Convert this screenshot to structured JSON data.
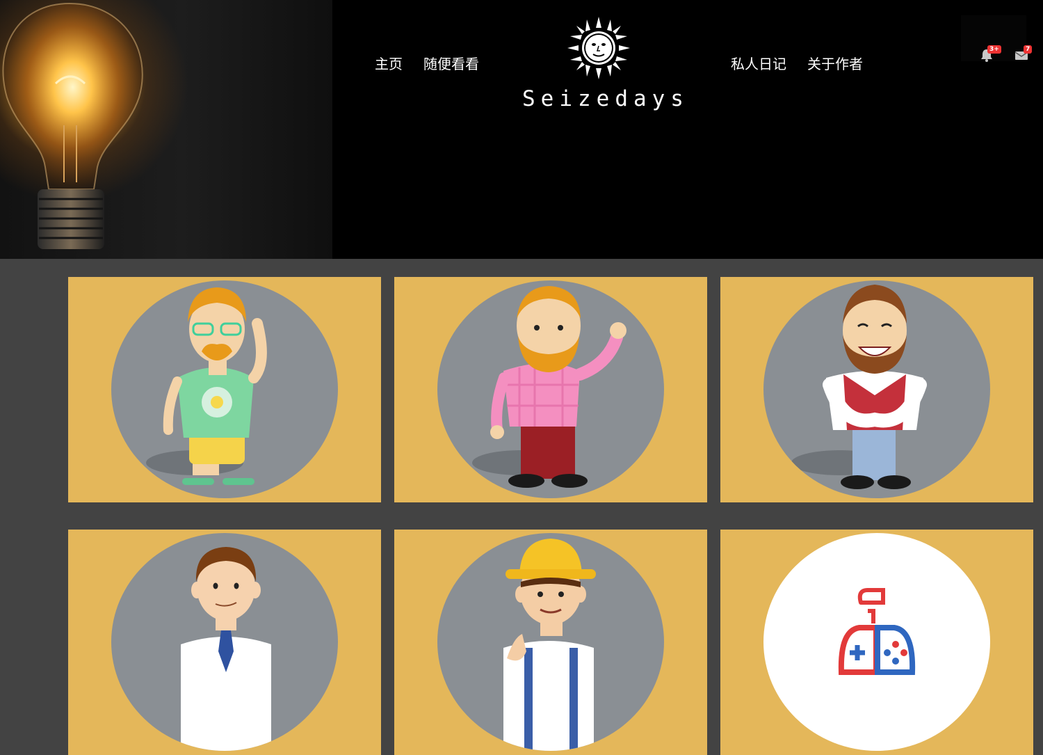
{
  "nav": {
    "left": [
      "主页",
      "随便看看"
    ],
    "right": [
      "私人日记",
      "关于作者"
    ]
  },
  "logo": {
    "text": "Seizedays"
  },
  "notifications": {
    "bell_badge": "3+",
    "mail_badge": "7"
  },
  "colors": {
    "card_bg": "#e4b75a",
    "circle_bg": "#8a8f94",
    "page_bg": "#434343",
    "header_bg": "#000000"
  },
  "cards": [
    {
      "icon": "hipster-man-avatar"
    },
    {
      "icon": "bearded-man-waving-avatar"
    },
    {
      "icon": "laughing-man-avatar"
    },
    {
      "icon": "office-man-avatar"
    },
    {
      "icon": "construction-worker-avatar"
    },
    {
      "icon": "gamepad-icon"
    }
  ]
}
